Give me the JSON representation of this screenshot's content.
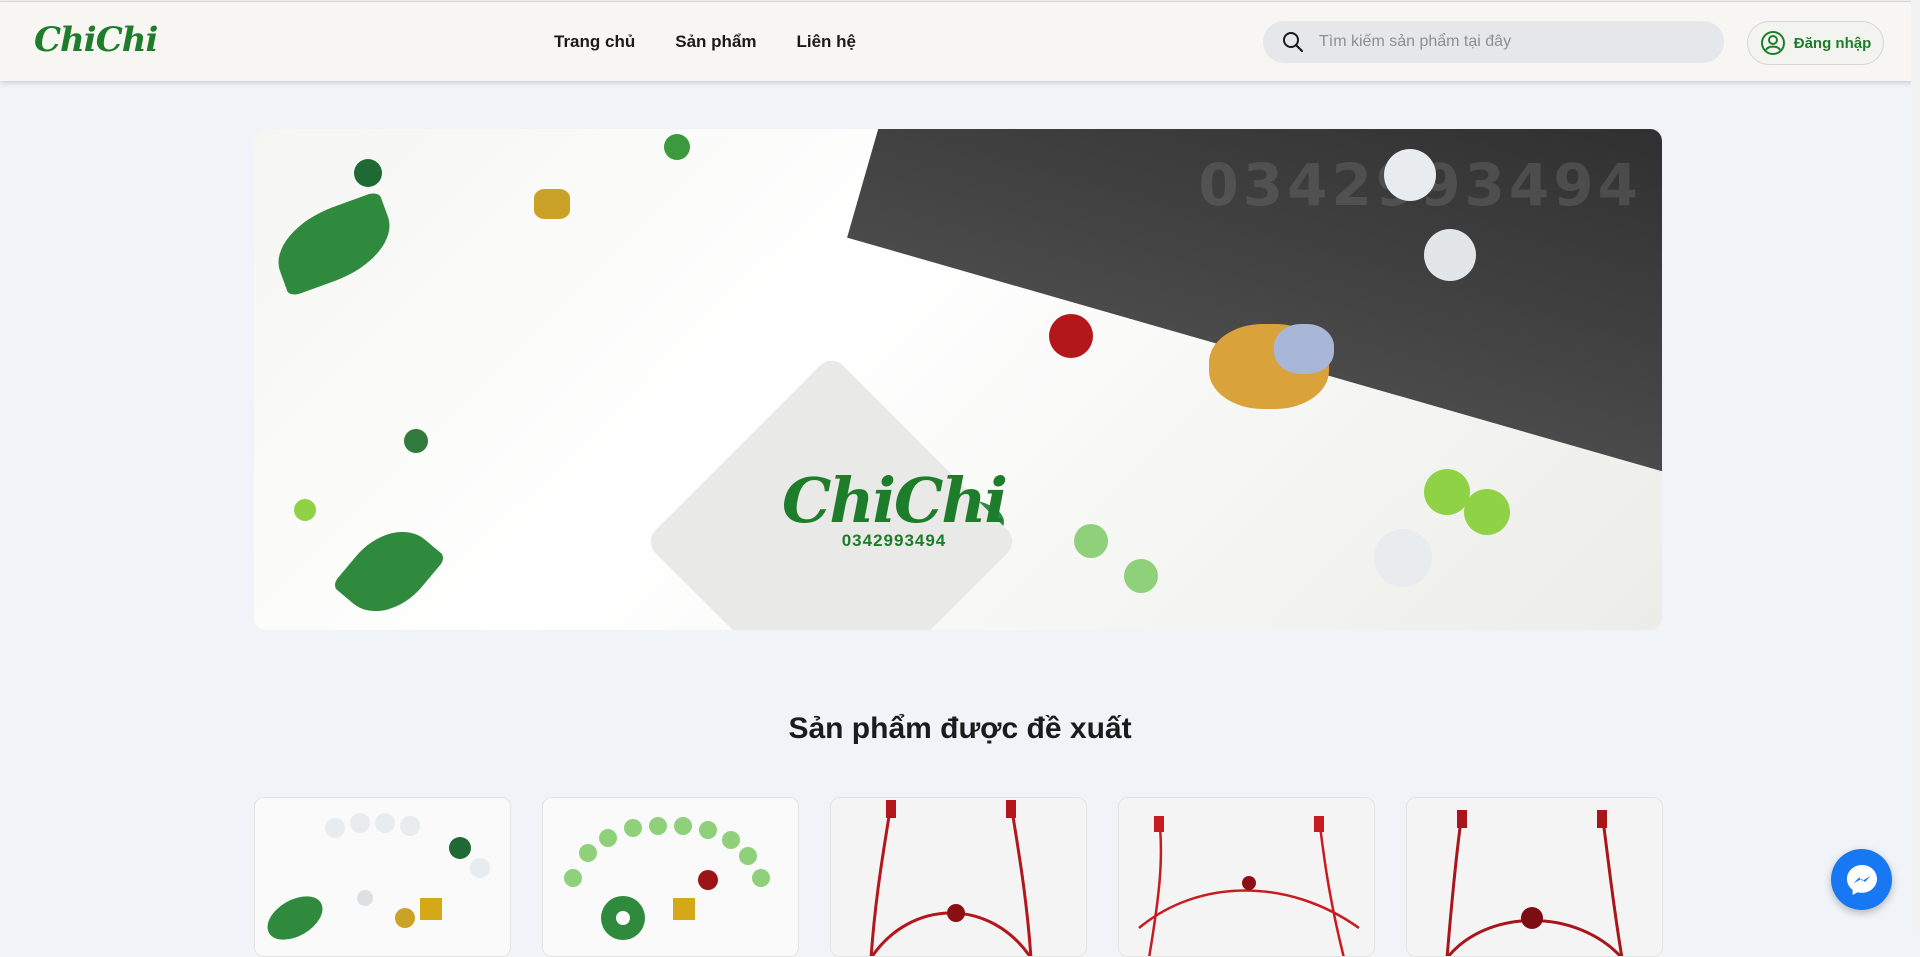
{
  "header": {
    "logo_text": "ChiChi",
    "nav": [
      {
        "label": "Trang chủ"
      },
      {
        "label": "Sản phẩm"
      },
      {
        "label": "Liên hệ"
      }
    ],
    "search": {
      "placeholder": "Tìm kiếm sản phẩm tại đây",
      "value": ""
    },
    "login_label": "Đăng nhập"
  },
  "banner": {
    "logo_text": "ChiChi",
    "phone": "0342993494",
    "watermark": "0342993494"
  },
  "recommended": {
    "title": "Sản phẩm được đề xuất",
    "products": [
      {
        "image": "jade-leaf-bracelet"
      },
      {
        "image": "green-bead-donut-bracelet"
      },
      {
        "image": "red-string-bracelet"
      },
      {
        "image": "red-string-bracelet"
      },
      {
        "image": "red-string-bracelet"
      }
    ]
  },
  "icons": {
    "search": "search-icon",
    "user": "user-circle-icon",
    "messenger": "messenger-icon"
  },
  "colors": {
    "brand_green": "#1e7d2a",
    "messenger_blue": "#1877f2",
    "background": "#f0f3f8",
    "header_bg": "#f7f6f3"
  }
}
